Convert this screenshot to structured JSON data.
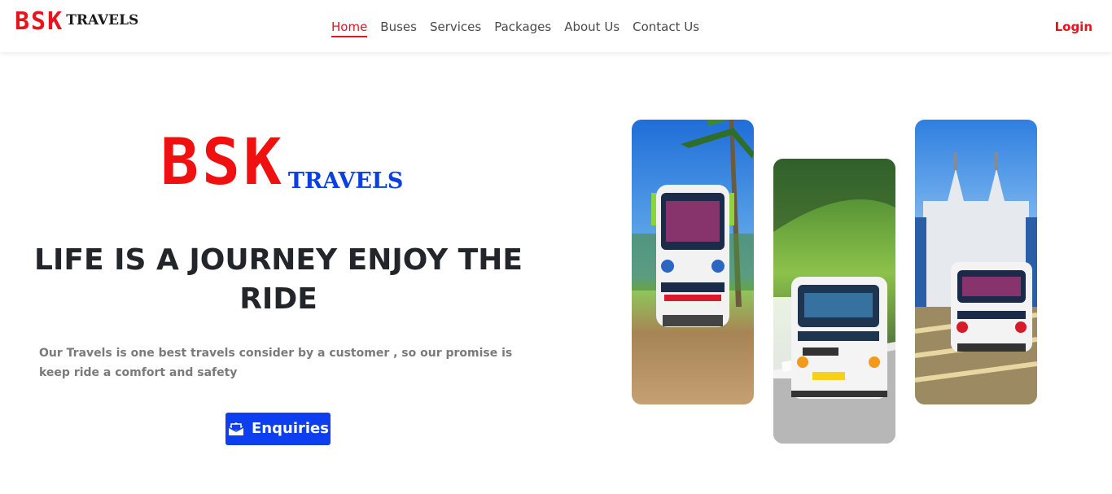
{
  "nav": {
    "brand_main": "BSK",
    "brand_sub": "TRAVELS",
    "links": [
      {
        "label": "Home",
        "active": true
      },
      {
        "label": "Buses",
        "active": false
      },
      {
        "label": "Services",
        "active": false
      },
      {
        "label": "Packages",
        "active": false
      },
      {
        "label": "About Us",
        "active": false
      },
      {
        "label": "Contact Us",
        "active": false
      }
    ],
    "login_label": "Login"
  },
  "hero": {
    "logo_main": "BSK",
    "logo_sub": "TRAVELS",
    "title": "LIFE IS A JOURNEY ENJOY THE RIDE",
    "description": "Our Travels is one best travels consider by a customer , so our promise is keep ride a comfort and safety",
    "cta_label": "Enquiries",
    "cta_icon": "envelope-open-icon"
  },
  "gallery": {
    "photos": [
      {
        "subject": "bus-under-palm-tree"
      },
      {
        "subject": "bus-on-hill-road"
      },
      {
        "subject": "bus-in-front-of-church"
      }
    ]
  },
  "colors": {
    "brand_red": "#e8141c",
    "brand_blue": "#0a3fe0",
    "cta_blue": "#0d3ef0",
    "title_dark": "#22262a",
    "text_gray": "#7a7a7a"
  }
}
